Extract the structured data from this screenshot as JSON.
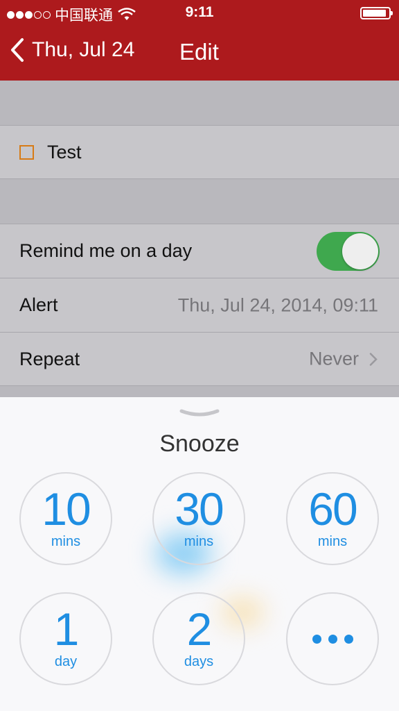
{
  "status_bar": {
    "carrier": "中国联通",
    "time": "9:11"
  },
  "nav": {
    "back_label": "Thu, Jul 24",
    "title": "Edit"
  },
  "task": {
    "title": "Test"
  },
  "settings": {
    "remind_label": "Remind me on a day",
    "remind_on": true,
    "alert_label": "Alert",
    "alert_value": "Thu, Jul 24, 2014, 09:11",
    "repeat_label": "Repeat",
    "repeat_value": "Never"
  },
  "snooze": {
    "title": "Snooze",
    "options": [
      {
        "value": "10",
        "unit": "mins"
      },
      {
        "value": "30",
        "unit": "mins"
      },
      {
        "value": "60",
        "unit": "mins"
      },
      {
        "value": "1",
        "unit": "day"
      },
      {
        "value": "2",
        "unit": "days"
      }
    ],
    "more_icon": "ellipsis-icon"
  },
  "colors": {
    "header": "#ad1a1d",
    "accent": "#1f8ee2",
    "toggle_on": "#3fa84e",
    "checkbox": "#d77b16"
  }
}
